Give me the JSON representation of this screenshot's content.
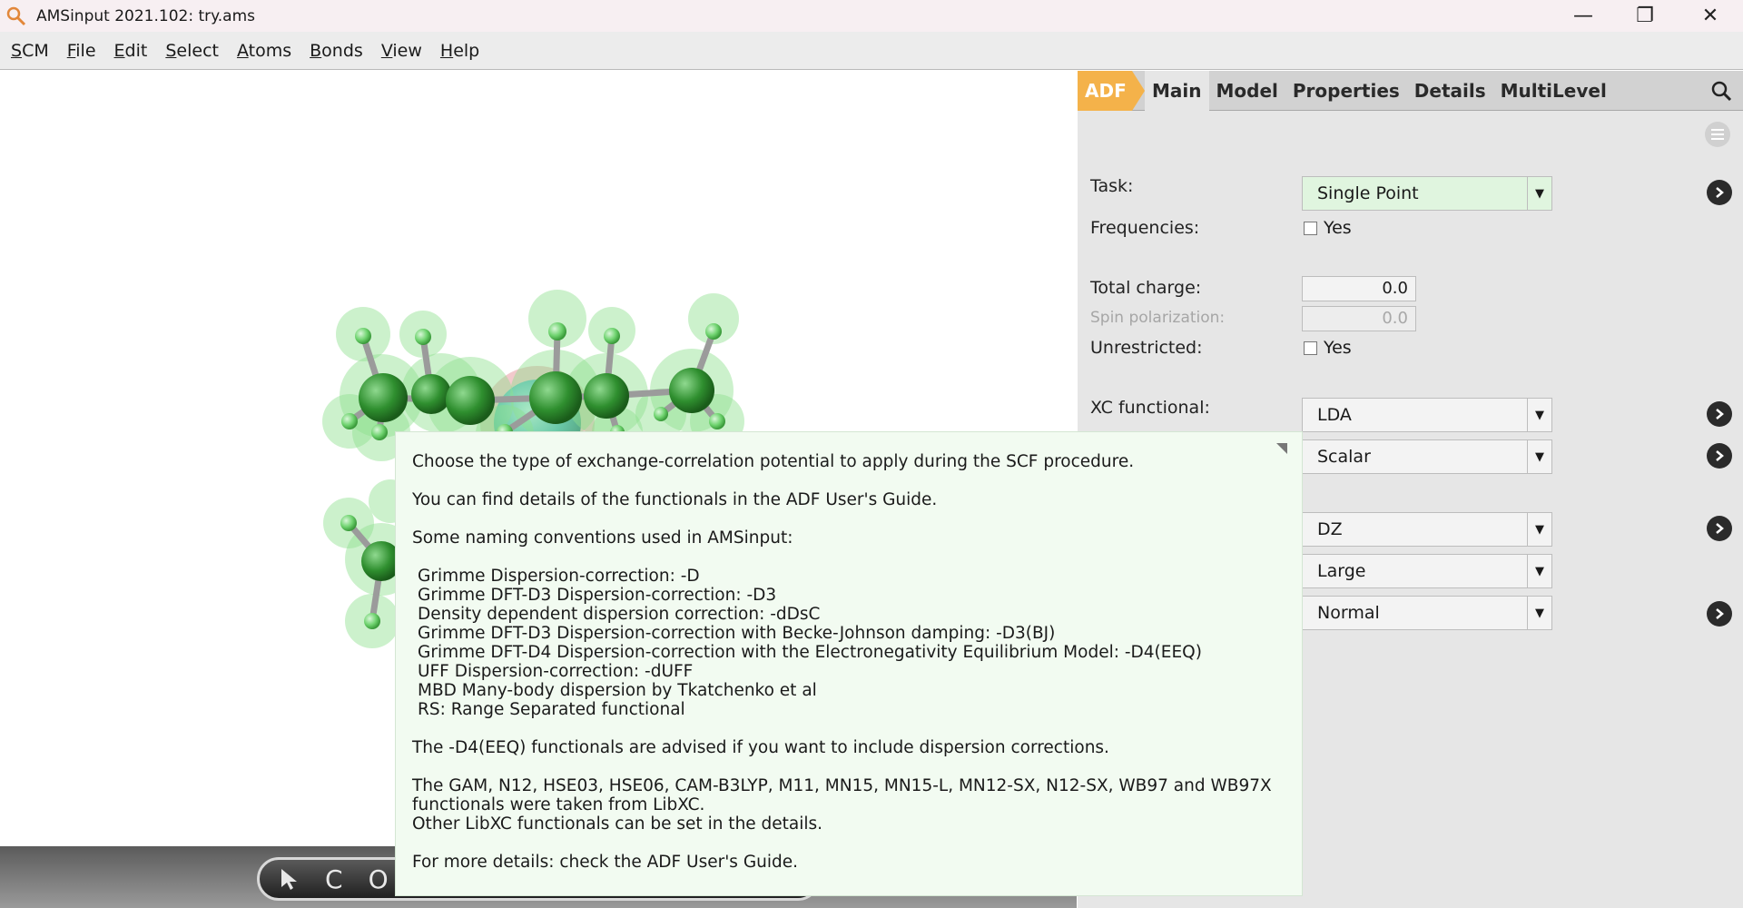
{
  "window": {
    "title": "AMSinput 2021.102: try.ams",
    "minimize_glyph": "—",
    "restore_glyph": "❐",
    "close_glyph": "✕"
  },
  "menubar": {
    "items": [
      "SCM",
      "File",
      "Edit",
      "Select",
      "Atoms",
      "Bonds",
      "View",
      "Help"
    ]
  },
  "viewer": {
    "toolbar_glyphs": [
      "C",
      "O"
    ],
    "atom_colors": {
      "carbon": "#2f8f2f",
      "hydrogen": "#6fd36f",
      "halo": "#bfe9bf",
      "metal": "#4fb7bf",
      "metal_halo": "#e8a3a8"
    }
  },
  "panel": {
    "engine_tab": "ADF",
    "tabs": [
      "Main",
      "Model",
      "Properties",
      "Details",
      "MultiLevel"
    ],
    "active_tab": "Main",
    "task_label": "Task:",
    "task_value": "Single Point",
    "frequencies_label": "Frequencies:",
    "frequencies_option": "Yes",
    "total_charge_label": "Total charge:",
    "total_charge_value": "0.0",
    "spin_polarization_label": "Spin polarization:",
    "spin_polarization_value": "0.0",
    "unrestricted_label": "Unrestricted:",
    "unrestricted_option": "Yes",
    "xc_functional_label": "XC functional:",
    "xc_functional_value": "LDA",
    "relativity_value": "Scalar",
    "basis_value": "DZ",
    "frozen_core_value": "Large",
    "numerical_quality_value": "Normal"
  },
  "tooltip": {
    "line1": "Choose the type of exchange-correlation potential to apply during the SCF procedure.",
    "line2": "You can find details of the functionals in the ADF User's Guide.",
    "line3": "Some naming conventions used in AMSinput:",
    "conventions": [
      "Grimme Dispersion-correction: -D",
      "Grimme DFT-D3 Dispersion-correction: -D3",
      "Density dependent dispersion correction: -dDsC",
      "Grimme DFT-D3 Dispersion-correction with Becke-Johnson damping: -D3(BJ)",
      "Grimme DFT-D4 Dispersion-correction with the Electronegativity Equilibrium Model: -D4(EEQ)",
      "UFF Dispersion-correction: -dUFF",
      "MBD Many-body dispersion by Tkatchenko et al",
      "RS: Range Separated functional"
    ],
    "line4": "The -D4(EEQ) functionals are advised if you want to include dispersion corrections.",
    "line5a": "The GAM, N12, HSE03, HSE06, CAM-B3LYP, M11, MN15, MN15-L, MN12-SX, N12-SX, WB97 and WB97X",
    "line5b": "functionals were taken from LibXC.",
    "line5c": "Other LibXC functionals can be set in the details.",
    "line6": "For more details: check the ADF User's Guide."
  }
}
